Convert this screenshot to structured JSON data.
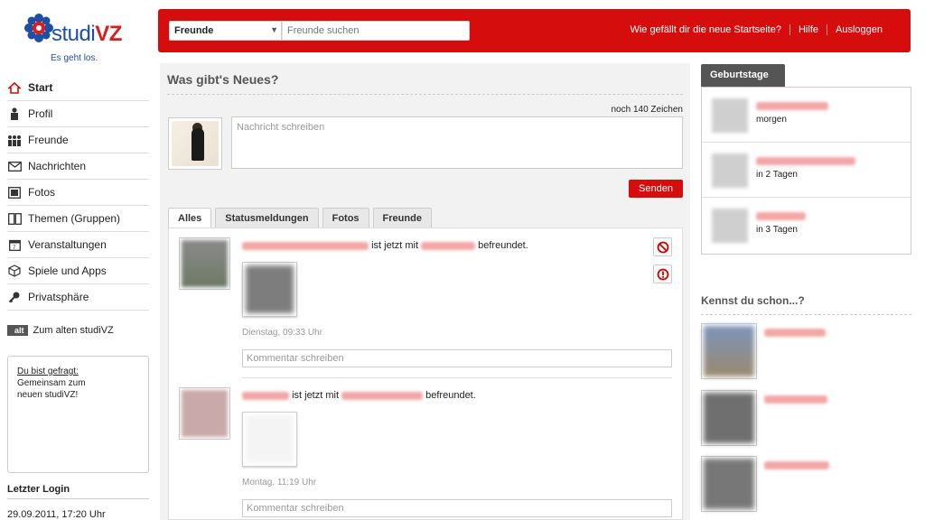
{
  "logo": {
    "brand_prefix": "studi",
    "brand_suffix": "VZ",
    "claim": "Es geht los."
  },
  "header": {
    "search_category": "Freunde",
    "search_placeholder": "Freunde suchen",
    "links": [
      "Wie gefällt dir die neue Startseite?",
      "Hilfe",
      "Ausloggen"
    ],
    "color": "#d60d0d"
  },
  "sidebar": {
    "items": [
      {
        "label": "Start",
        "icon": "home-icon"
      },
      {
        "label": "Profil",
        "icon": "person-icon"
      },
      {
        "label": "Freunde",
        "icon": "friends-icon"
      },
      {
        "label": "Nachrichten",
        "icon": "envelope-icon"
      },
      {
        "label": "Fotos",
        "icon": "photo-icon"
      },
      {
        "label": "Themen (Gruppen)",
        "icon": "groups-icon"
      },
      {
        "label": "Veranstaltungen",
        "icon": "calendar-icon"
      },
      {
        "label": "Spiele und Apps",
        "icon": "cube-icon"
      },
      {
        "label": "Privatsphäre",
        "icon": "key-icon"
      }
    ],
    "old_badge": "alt",
    "old_link": "Zum alten studiVZ",
    "asked_link": "Du bist gefragt:",
    "asked_text": "Gemeinsam zum neuen studiVZ!",
    "last_login_heading": "Letzter Login",
    "last_login_value": "29.09.2011, 17:20 Uhr"
  },
  "main": {
    "heading": "Was gibt's Neues?",
    "chars_left": "noch 140 Zeichen",
    "message_placeholder": "Nachricht schreiben",
    "send_label": "Senden",
    "tabs": [
      "Alles",
      "Statusmeldungen",
      "Fotos",
      "Freunde"
    ],
    "posts": [
      {
        "text_mid": "ist jetzt mit",
        "text_end": "befreundet.",
        "time": "Dienstag, 09:33 Uhr",
        "comment_placeholder": "Kommentar schreiben"
      },
      {
        "text_mid": "ist jetzt mit",
        "text_end": "befreundet.",
        "time": "Montag, 11:19 Uhr",
        "comment_placeholder": "Kommentar schreiben"
      }
    ]
  },
  "right": {
    "birthdays_tab": "Geburtstage",
    "birthdays": [
      {
        "when": "morgen"
      },
      {
        "when": "in 2 Tagen"
      },
      {
        "when": "in 3 Tagen"
      }
    ],
    "know_heading": "Kennst du schon...?"
  }
}
